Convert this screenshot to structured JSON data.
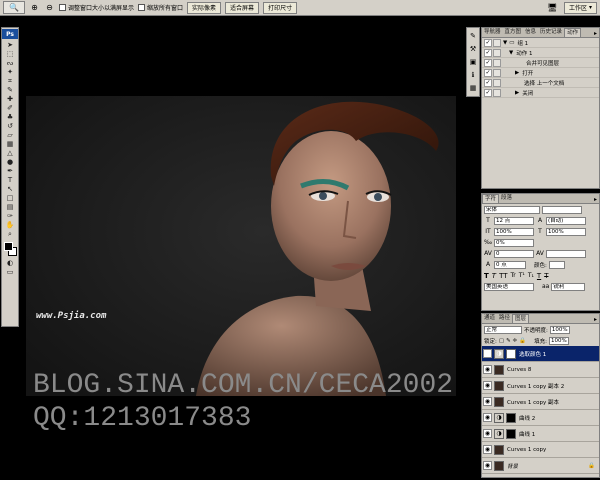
{
  "options_bar": {
    "tool_icon": "zoom-icon",
    "check_resize": "调整窗口大小以满屏显示",
    "check_zoom_all": "缩放所有窗口",
    "btn_actual": "实际像素",
    "btn_fit": "适合屏幕",
    "btn_print": "打印尺寸",
    "workspace": "工作区"
  },
  "toolbox": {
    "logo": "Ps"
  },
  "canvas": {
    "watermark": "www.Psjia.com",
    "blog_text": "BLOG.SINA.COM.CN/CECA2002",
    "qq_text": "QQ:1213017383"
  },
  "actions_panel": {
    "tabs": [
      "导航器",
      "直方图",
      "信息",
      "历史记录",
      "动作"
    ],
    "active_tab": "动作",
    "rows": [
      {
        "label": "组 1",
        "indent": 0,
        "expand": "▼"
      },
      {
        "label": "动作 1",
        "indent": 1,
        "expand": "▼"
      },
      {
        "label": "合并可见图层",
        "indent": 3,
        "expand": ""
      },
      {
        "label": "打开",
        "indent": 2,
        "expand": "▶"
      },
      {
        "label": "选择 上一个文档",
        "indent": 2,
        "expand": ""
      },
      {
        "label": "关闭",
        "indent": 2,
        "expand": "▶"
      }
    ]
  },
  "character_panel": {
    "tabs": [
      "字符",
      "段落"
    ],
    "font_family": "宋体",
    "font_size": "12 点",
    "leading": "(自动)",
    "scale_v": "100%",
    "scale_h": "100%",
    "tracking": "0%",
    "kerning": "0",
    "baseline": "0 点",
    "color_label": "颜色:",
    "language": "美国英语",
    "aa_label": "aa",
    "aa_method": "锐利"
  },
  "layers_panel": {
    "tabs": [
      "通道",
      "路径",
      "图层"
    ],
    "active_tab": "图层",
    "blend_mode": "正常",
    "opacity_label": "不透明度:",
    "opacity": "100%",
    "lock_label": "锁定:",
    "fill_label": "填充:",
    "fill": "100%",
    "layers": [
      {
        "name": "选取颜色 1",
        "kind": "adj",
        "selected": true
      },
      {
        "name": "Curves 8",
        "kind": "img",
        "selected": false
      },
      {
        "name": "Curves 1 copy 副本 2",
        "kind": "img",
        "selected": false
      },
      {
        "name": "Curves 1 copy 副本",
        "kind": "img",
        "selected": false
      },
      {
        "name": "曲线 2",
        "kind": "adj",
        "selected": false
      },
      {
        "name": "曲线 1",
        "kind": "adj",
        "selected": false
      },
      {
        "name": "Curves 1 copy",
        "kind": "img",
        "selected": false
      },
      {
        "name": "背景",
        "kind": "img",
        "selected": false
      }
    ]
  }
}
